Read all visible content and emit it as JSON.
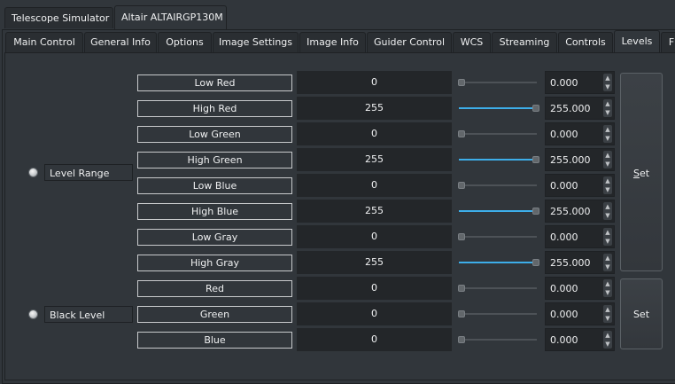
{
  "device_tabs": [
    {
      "label": "Telescope Simulator",
      "active": false
    },
    {
      "label": "Altair ALTAIRGP130M",
      "active": true
    }
  ],
  "property_tabs": [
    {
      "label": "Main Control",
      "active": false
    },
    {
      "label": "General Info",
      "active": false
    },
    {
      "label": "Options",
      "active": false
    },
    {
      "label": "Image Settings",
      "active": false
    },
    {
      "label": "Image Info",
      "active": false
    },
    {
      "label": "Guider Control",
      "active": false
    },
    {
      "label": "WCS",
      "active": false
    },
    {
      "label": "Streaming",
      "active": false
    },
    {
      "label": "Controls",
      "active": false
    },
    {
      "label": "Levels",
      "active": true
    },
    {
      "label": "F",
      "active": false
    }
  ],
  "groups": [
    {
      "label": "Level Range",
      "set_label": "Set",
      "set_mnemonic": "S"
    },
    {
      "label": "Black Level",
      "set_label": "Set"
    }
  ],
  "rows": [
    {
      "label": "Low Red",
      "value": "0",
      "spin": "0.000",
      "slider_fraction": 0
    },
    {
      "label": "High Red",
      "value": "255",
      "spin": "255.000",
      "slider_fraction": 1
    },
    {
      "label": "Low Green",
      "value": "0",
      "spin": "0.000",
      "slider_fraction": 0
    },
    {
      "label": "High Green",
      "value": "255",
      "spin": "255.000",
      "slider_fraction": 1
    },
    {
      "label": "Low Blue",
      "value": "0",
      "spin": "0.000",
      "slider_fraction": 0
    },
    {
      "label": "High Blue",
      "value": "255",
      "spin": "255.000",
      "slider_fraction": 1
    },
    {
      "label": "Low Gray",
      "value": "0",
      "spin": "0.000",
      "slider_fraction": 0
    },
    {
      "label": "High Gray",
      "value": "255",
      "spin": "255.000",
      "slider_fraction": 1
    },
    {
      "label": "Red",
      "value": "0",
      "spin": "0.000",
      "slider_fraction": 0
    },
    {
      "label": "Green",
      "value": "0",
      "spin": "0.000",
      "slider_fraction": 0
    },
    {
      "label": "Blue",
      "value": "0",
      "spin": "0.000",
      "slider_fraction": 0
    }
  ],
  "colors": {
    "accent": "#3daee9",
    "background": "#31363b",
    "field": "#232629"
  }
}
